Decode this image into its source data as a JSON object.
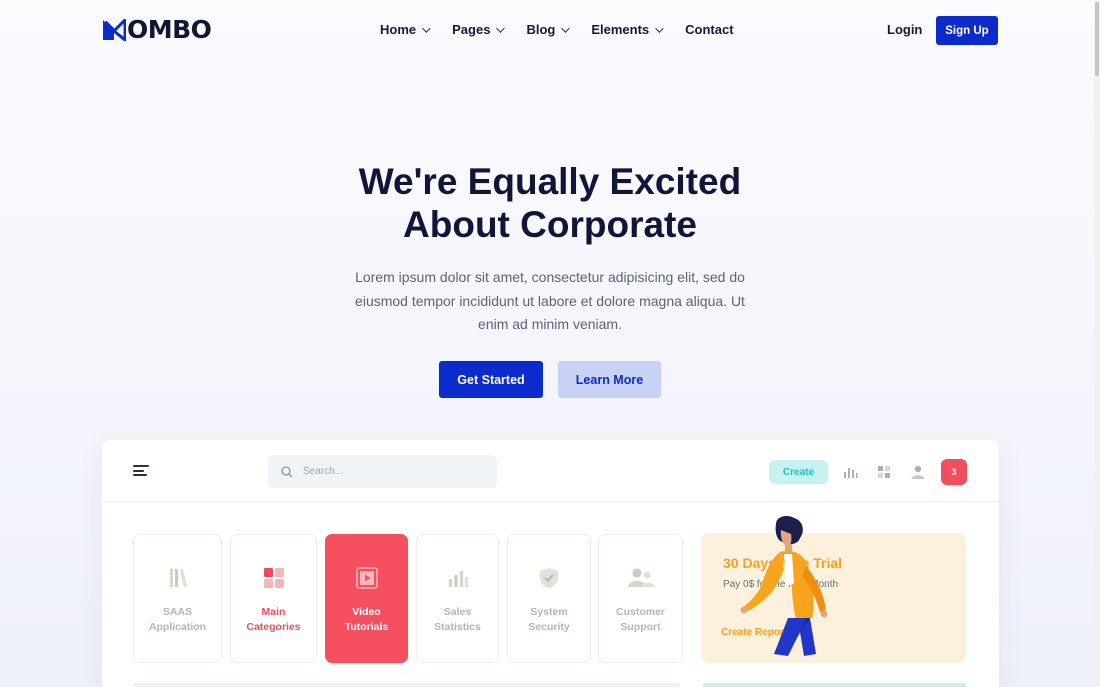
{
  "nav": {
    "logo_text": "OMBO",
    "menu": [
      {
        "label": "Home",
        "has_dropdown": true
      },
      {
        "label": "Pages",
        "has_dropdown": true
      },
      {
        "label": "Blog",
        "has_dropdown": true
      },
      {
        "label": "Elements",
        "has_dropdown": true
      },
      {
        "label": "Contact",
        "has_dropdown": false
      }
    ],
    "login": "Login",
    "signup": "Sign Up"
  },
  "hero": {
    "title_line1": "We're Equally Excited",
    "title_line2": "About Corporate",
    "description": "Lorem ipsum dolor sit amet, consectetur adipisicing elit, sed do eiusmod tempor incididunt ut labore et dolore magna aliqua. Ut enim ad minim veniam.",
    "primary_button": "Get Started",
    "secondary_button": "Learn More"
  },
  "dashboard": {
    "search_placeholder": "Search...",
    "create_label": "Create",
    "notification_count": "3",
    "categories": [
      {
        "line1": "SAAS",
        "line2": "Application",
        "icon": "books-icon",
        "state": "default"
      },
      {
        "line1": "Main",
        "line2": "Categories",
        "icon": "grid-icon",
        "state": "highlight"
      },
      {
        "line1": "Video",
        "line2": "Tutorials",
        "icon": "video-icon",
        "state": "active"
      },
      {
        "line1": "Sales",
        "line2": "Statistics",
        "icon": "bar-chart-icon",
        "state": "default"
      },
      {
        "line1": "System",
        "line2": "Security",
        "icon": "shield-icon",
        "state": "default"
      },
      {
        "line1": "Customer",
        "line2": "Support",
        "icon": "users-icon",
        "state": "default"
      }
    ],
    "promo": {
      "title": "30 Days Free Trial",
      "subtitle": "Pay 0$ for the First Month",
      "link": "Create Report"
    }
  },
  "colors": {
    "brand_blue": "#0b2bcd",
    "accent_red": "#f64f60",
    "accent_orange": "#f5a11e",
    "accent_teal": "#1fbfbf"
  }
}
